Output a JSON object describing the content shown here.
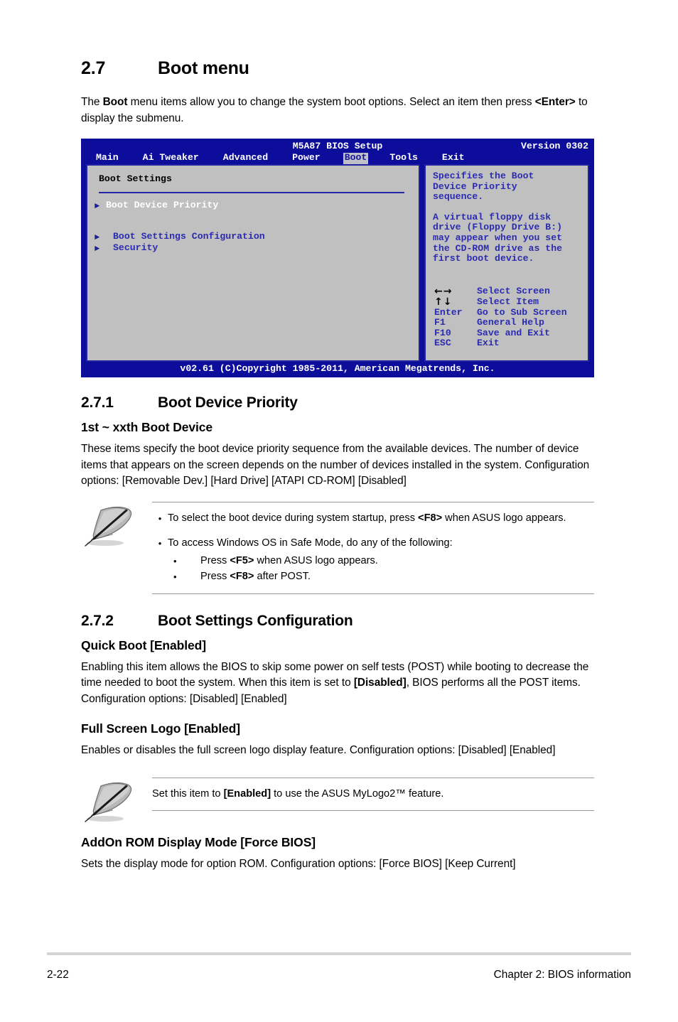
{
  "section": {
    "number": "2.7",
    "title": "Boot menu",
    "intro_a": "The ",
    "intro_b": "Boot",
    "intro_c": " menu items allow you to change the system boot options. Select an item then press ",
    "intro_d": "<Enter>",
    "intro_e": " to display the submenu."
  },
  "bios": {
    "title": "M5A87 BIOS Setup",
    "version": "Version 0302",
    "tabs": [
      {
        "label": "Main",
        "active": false
      },
      {
        "label": "Ai Tweaker",
        "active": false
      },
      {
        "label": "Advanced",
        "active": false
      },
      {
        "label": "Power",
        "active": false
      },
      {
        "label": "Boot",
        "active": true
      },
      {
        "label": "Tools",
        "active": false
      },
      {
        "label": "Exit",
        "active": false
      }
    ],
    "pane_title": "Boot Settings",
    "menu": [
      {
        "label": "Boot Device Priority",
        "selected": true
      },
      {
        "label": "Boot Settings Configuration",
        "selected": false
      },
      {
        "label": "Security",
        "selected": false
      }
    ],
    "help_paragraph_1": [
      "Specifies the Boot",
      "Device Priority",
      "sequence."
    ],
    "help_paragraph_2": [
      "A virtual floppy disk",
      "drive (Floppy Drive B:)",
      "may appear when you set",
      "the CD-ROM drive as the",
      "first boot device."
    ],
    "keys": [
      {
        "key": "←→",
        "glyph": true,
        "action": "Select Screen"
      },
      {
        "key": "↑↓",
        "glyph": true,
        "action": "Select Item"
      },
      {
        "key": "Enter",
        "glyph": false,
        "action": "Go to Sub Screen"
      },
      {
        "key": "F1",
        "glyph": false,
        "action": "General Help"
      },
      {
        "key": "F10",
        "glyph": false,
        "action": "Save and Exit"
      },
      {
        "key": "ESC",
        "glyph": false,
        "action": "Exit"
      }
    ],
    "footer": "v02.61 (C)Copyright 1985-2011, American Megatrends, Inc.",
    "colors": {
      "chrome_blue": "#0d0d9c",
      "pane_gray": "#c0c0c0",
      "pane_border": "#2222a0",
      "help_text": "#2b2bb0",
      "selected_text": "#ffffff"
    }
  },
  "sub1": {
    "number": "2.7.1",
    "title": "Boot Device Priority",
    "heading": "1st ~ xxth Boot Device",
    "paragraph": "These items specify the boot device priority sequence from the available devices. The number of device items that appears on the screen depends on the number of devices installed in the system. Configuration options: [Removable Dev.] [Hard Drive] [ATAPI CD-ROM] [Disabled]"
  },
  "note1": {
    "icon": "note-quill-icon",
    "b1_a": "To select the boot device during system startup, press ",
    "b1_b": "<F8>",
    "b1_c": " when ASUS logo appears.",
    "b2": "To access Windows OS in Safe Mode, do any of the following:",
    "b2_s1_a": "Press ",
    "b2_s1_b": "<F5>",
    "b2_s1_c": " when ASUS logo appears.",
    "b2_s2_a": "Press ",
    "b2_s2_b": "<F8>",
    "b2_s2_c": " after POST.",
    "bullet": "•"
  },
  "sub2": {
    "number": "2.7.2",
    "title": "Boot Settings Configuration",
    "item1_heading": "Quick Boot [Enabled]",
    "item1_p_a": "Enabling this item allows the BIOS to skip some power on self tests (POST) while booting to decrease the time needed to boot the system. When this item is set to ",
    "item1_p_b": "[Disabled]",
    "item1_p_c": ", BIOS performs all the POST items. Configuration options: [Disabled] [Enabled]",
    "item2_heading": "Full Screen Logo [Enabled]",
    "item2_p": "Enables or disables the full screen logo display feature. Configuration options: [Disabled] [Enabled]",
    "item3_heading": "AddOn ROM Display Mode [Force BIOS]",
    "item3_p": "Sets the display mode for option ROM. Configuration options: [Force BIOS] [Keep Current]"
  },
  "note2": {
    "icon": "note-quill-icon",
    "a": "Set this item to ",
    "b": "[Enabled]",
    "c": " to use the ASUS MyLogo2™ feature."
  },
  "footer": {
    "page_number": "2-22",
    "chapter": "Chapter 2: BIOS information"
  }
}
